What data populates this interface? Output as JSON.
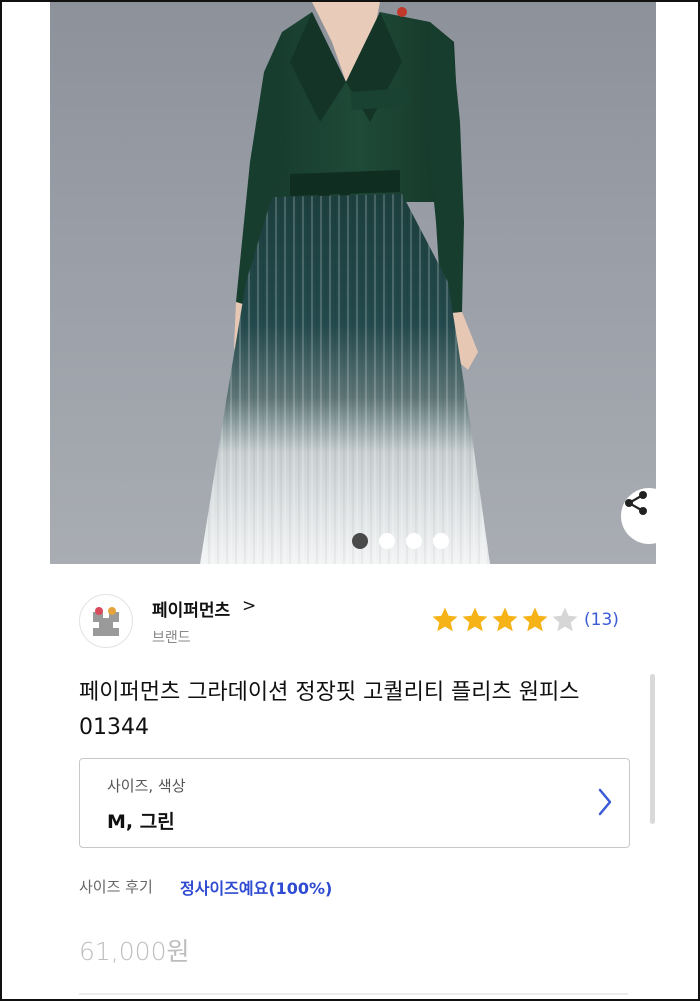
{
  "gallery": {
    "page_count": 4,
    "active_index": 0,
    "share_icon": "share-icon"
  },
  "brand": {
    "name": "페이퍼먼츠",
    "chevron": ">",
    "subtitle": "브랜드",
    "logo_icon": "brand-logo-icon"
  },
  "rating": {
    "stars": 4,
    "max_stars": 5,
    "count": "(13)",
    "star_color": "#f5b317",
    "empty_star_color": "#d6d6d6"
  },
  "product": {
    "title": "페이퍼먼츠 그라데이션 정장핏 고퀄리티 플리츠 원피스 01344",
    "price": "61,000원"
  },
  "option": {
    "label": "사이즈, 색상",
    "value": "M, 그린",
    "chevron_icon": "chevron-right-icon"
  },
  "size_review": {
    "label": "사이즈 후기",
    "value": "정사이즈예요(100%)"
  },
  "colors": {
    "accent_blue": "#3b5bd6",
    "dress_green": "#1f3f33"
  }
}
